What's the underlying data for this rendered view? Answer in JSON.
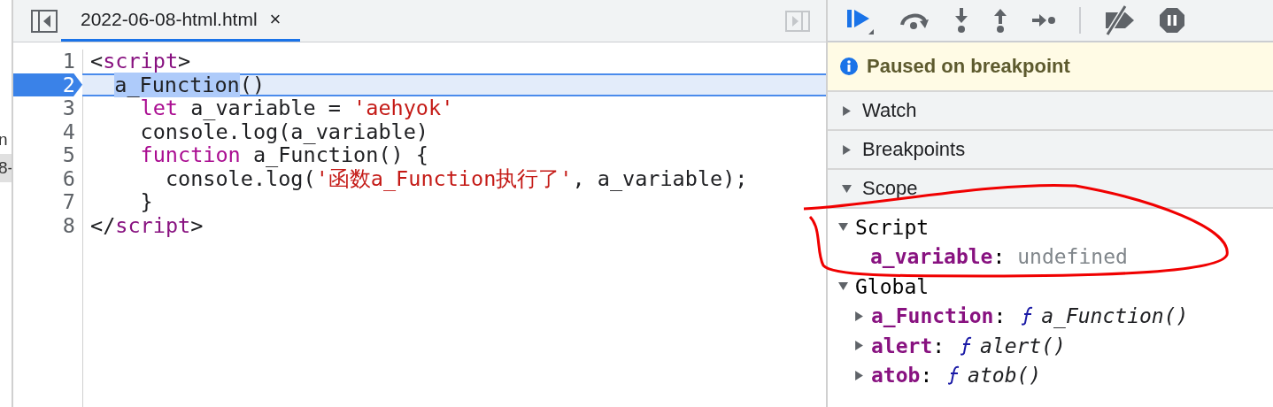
{
  "navigator": {
    "items": [
      {
        "label": "n",
        "selected": false
      },
      {
        "label": "8-",
        "selected": true
      }
    ]
  },
  "editor": {
    "tabs": [
      {
        "label": "2022-06-08-html.html",
        "close": "×",
        "selected": true
      }
    ],
    "lines": [
      {
        "number": "1",
        "paused": false,
        "tokens": [
          {
            "kind": "punct",
            "text": "<"
          },
          {
            "kind": "tag",
            "text": "script"
          },
          {
            "kind": "punct",
            "text": ">"
          }
        ],
        "children": [
          {
            "number": "2",
            "paused": true,
            "tokens": [
              {
                "kind": "selection",
                "text": "a_Function"
              },
              {
                "kind": "plain",
                "text": "()"
              }
            ],
            "children": [
              {
                "number": "3",
                "paused": false,
                "tokens": [
                  {
                    "kind": "keyword",
                    "text": "let"
                  },
                  {
                    "kind": "plain",
                    "text": " a_variable = "
                  },
                  {
                    "kind": "string",
                    "text": "'aehyok'"
                  }
                ]
              },
              {
                "number": "4",
                "paused": false,
                "tokens": [
                  {
                    "kind": "plain",
                    "text": "console.log(a_variable)"
                  }
                ]
              },
              {
                "number": "5",
                "paused": false,
                "tokens": [
                  {
                    "kind": "keyword",
                    "text": "function"
                  },
                  {
                    "kind": "plain",
                    "text": " a_Function() {"
                  }
                ],
                "children": [
                  {
                    "number": "6",
                    "paused": false,
                    "tokens": [
                      {
                        "kind": "plain",
                        "text": "console.log("
                      },
                      {
                        "kind": "string",
                        "text": "'函数a_Function执行了'"
                      },
                      {
                        "kind": "plain",
                        "text": ", a_variable);"
                      }
                    ]
                  }
                ]
              },
              {
                "number": "7",
                "paused": false,
                "tokens": [
                  {
                    "kind": "plain",
                    "text": "}"
                  }
                ]
              }
            ]
          }
        ]
      },
      {
        "number": "8",
        "paused": false,
        "tokens": [
          {
            "kind": "punct",
            "text": "</"
          },
          {
            "kind": "tag",
            "text": "script"
          },
          {
            "kind": "punct",
            "text": ">"
          }
        ]
      }
    ]
  },
  "debugger": {
    "banner": "Paused on breakpoint",
    "sections": [
      {
        "title": "Watch",
        "expanded": false
      },
      {
        "title": "Breakpoints",
        "expanded": false
      },
      {
        "title": "Scope",
        "expanded": true
      }
    ],
    "scope": [
      {
        "title": "Script",
        "expanded": true,
        "children": [
          {
            "name": "a_variable",
            "colon": ":",
            "value": "undefined",
            "kind": "undefined"
          }
        ]
      },
      {
        "title": "Global",
        "expanded": true,
        "children": [
          {
            "name": "a_Function",
            "colon": ":",
            "value": "a_Function()",
            "kind": "function",
            "expanded": false
          },
          {
            "name": "alert",
            "colon": ":",
            "value": "alert()",
            "kind": "function",
            "expanded": false
          },
          {
            "name": "atob",
            "colon": ":",
            "value": "atob()",
            "kind": "function",
            "expanded": false
          }
        ]
      }
    ]
  }
}
